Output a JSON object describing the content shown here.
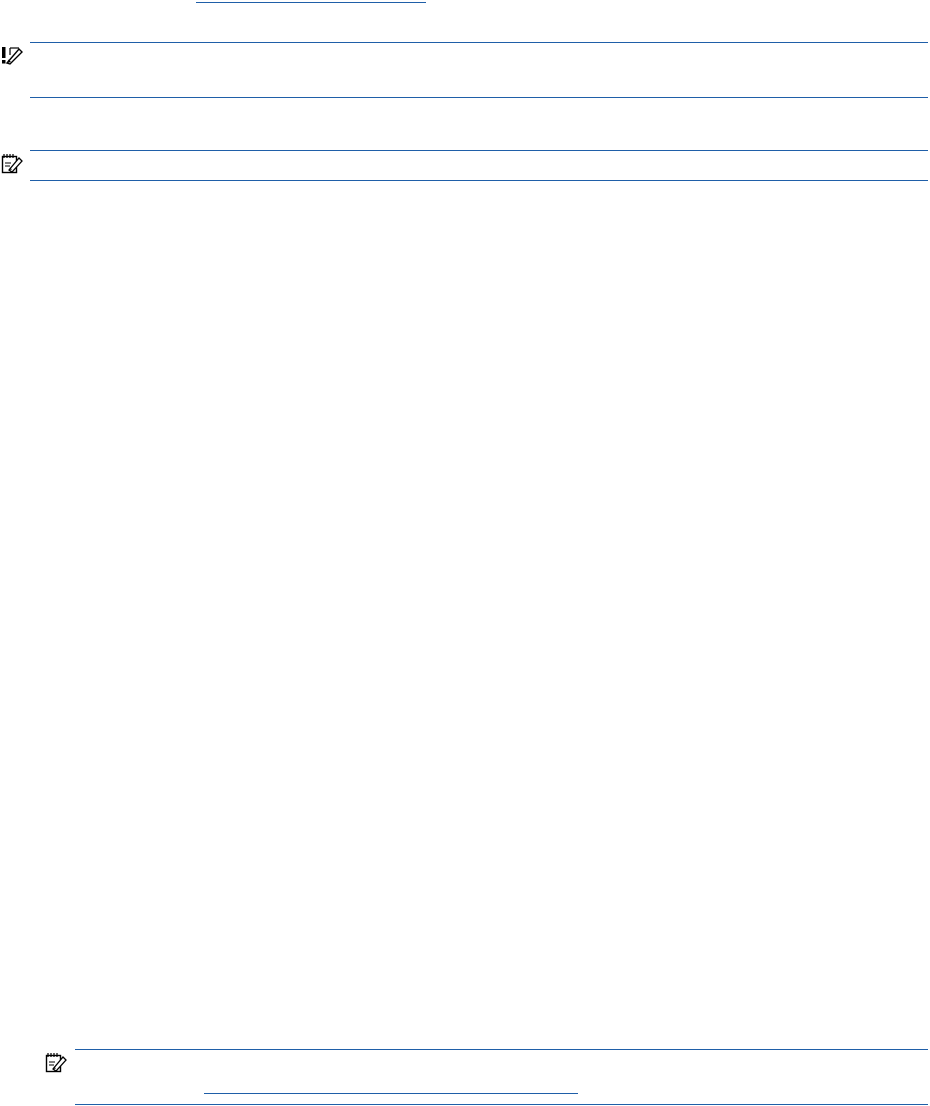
{
  "document": {
    "top_link": {
      "text": ""
    },
    "important_note": {
      "icon": "important-note-icon",
      "text": ""
    },
    "note_1": {
      "icon": "note-icon",
      "text": ""
    },
    "note_2": {
      "icon": "note-icon",
      "text": "",
      "link_text": ""
    }
  },
  "colors": {
    "rule": "#1f5fa8",
    "link": "#1f5fa8",
    "text": "#000000"
  }
}
